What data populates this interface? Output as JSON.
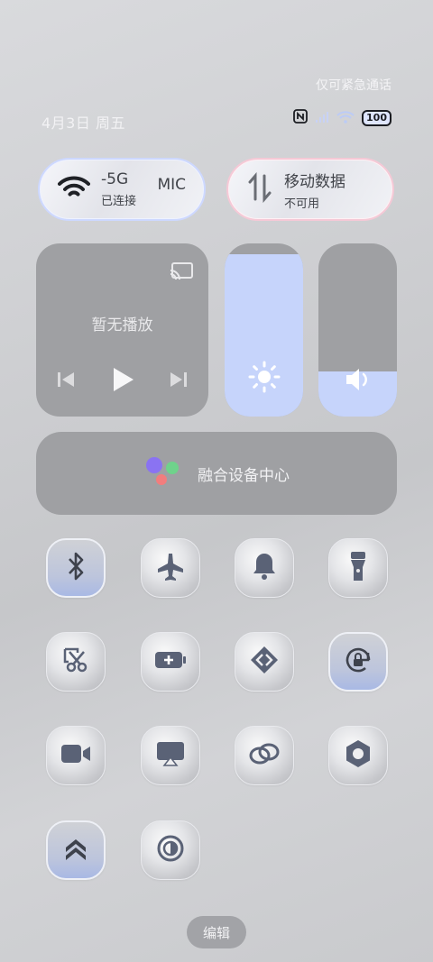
{
  "status": {
    "emergency_text": "仅可紧急通话",
    "date": "4月3日 周五",
    "battery_level": "100",
    "icons": [
      "nfc-icon",
      "signal-icon",
      "wifi-icon",
      "battery-icon"
    ]
  },
  "pills": {
    "wifi": {
      "name": "-5G",
      "status": "已连接",
      "extra": "MIC"
    },
    "data": {
      "name": "移动数据",
      "status": "不可用"
    }
  },
  "media": {
    "title": "暂无播放"
  },
  "sliders": {
    "brightness": 0.94,
    "volume": 0.26
  },
  "fusion": {
    "label": "融合设备中心"
  },
  "tiles": [
    "bluetooth-icon",
    "airplane-icon",
    "bell-icon",
    "flashlight-icon",
    "screenshot-icon",
    "battery-saver-icon",
    "nearby-share-icon",
    "rotation-lock-icon",
    "screen-record-icon",
    "projection-icon",
    "link-icon",
    "camera-icon",
    "double-chevron-up-icon",
    "dark-mode-icon"
  ],
  "edit": {
    "label": "编辑"
  },
  "colors": {
    "accent": "#c6d4fb",
    "panel": "#9fa0a3",
    "icon": "#5a6276"
  }
}
